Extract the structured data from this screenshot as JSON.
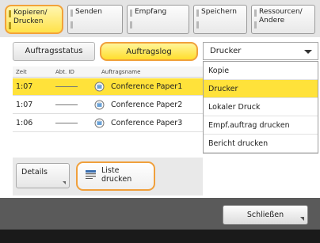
{
  "tabs": [
    {
      "label": "Kopieren/\nDrucken",
      "active": true
    },
    {
      "label": "Senden",
      "active": false
    },
    {
      "label": "Empfang",
      "active": false
    },
    {
      "label": "Speichern",
      "active": false
    },
    {
      "label": "Ressourcen/\nAndere",
      "active": false
    }
  ],
  "subtabs": {
    "status_label": "Auftragsstatus",
    "log_label": "Auftragslog"
  },
  "dropdown": {
    "value": "Drucker",
    "options": [
      "Kopie",
      "Drucker",
      "Lokaler Druck",
      "Empf.auftrag drucken",
      "Bericht drucken"
    ],
    "selected_index": 1
  },
  "table": {
    "headers": {
      "time": "Zeit",
      "id": "Abt. ID",
      "name": "Auftragsname"
    },
    "rows": [
      {
        "time": "1:07",
        "id": "——",
        "name": "Conference Paper1",
        "selected": true
      },
      {
        "time": "1:07",
        "id": "——",
        "name": "Conference Paper2",
        "selected": false
      },
      {
        "time": "1:06",
        "id": "——",
        "name": "Conference Paper3",
        "selected": false
      }
    ]
  },
  "buttons": {
    "details": "Details",
    "print_list_line1": "Liste",
    "print_list_line2": "drucken",
    "close": "Schließen"
  },
  "colors": {
    "highlight": "#ffe23a",
    "accent_border": "#f0a03c",
    "bottom_bar": "#5a5a5a"
  }
}
